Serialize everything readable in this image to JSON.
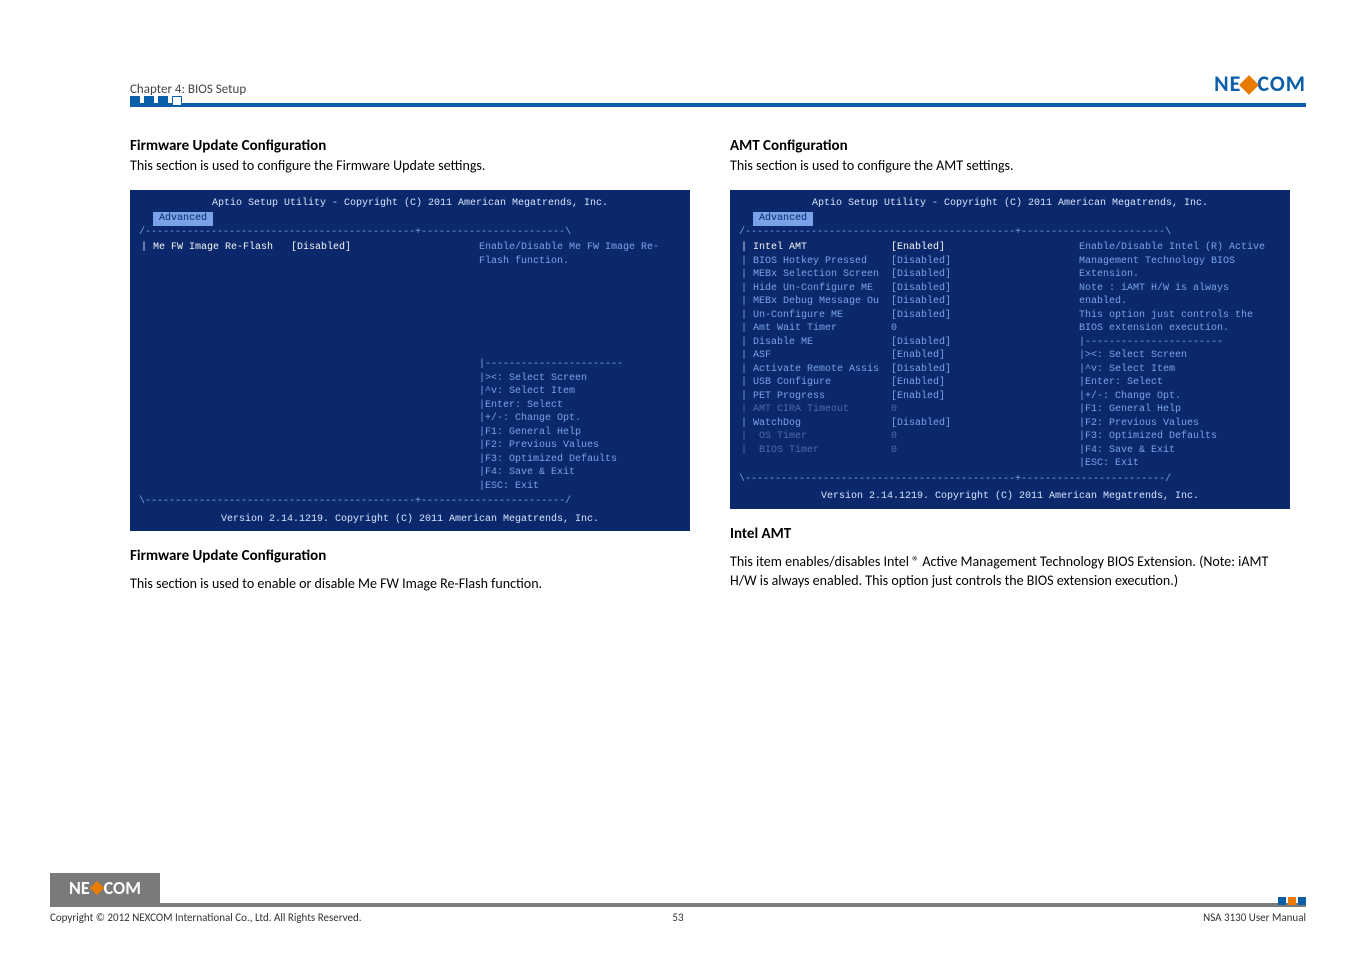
{
  "header": {
    "chapter": "Chapter 4: BIOS Setup"
  },
  "brand": {
    "left": "NE",
    "right": "COM"
  },
  "left": {
    "h_config": "Firmware Update Configuration",
    "desc_config": "This section is used to configure the Firmware Update settings.",
    "h_after": "Firmware Update Configuration",
    "desc_after": "This section is used to enable or disable Me FW Image Re-Flash function."
  },
  "right": {
    "h_config": "AMT Configuration",
    "desc_config": "This section is used to configure the AMT settings.",
    "h_after": "Intel AMT",
    "desc_after": "This item enables/disables Intel ® Active Management Technology BIOS Extension. (Note: iAMT H/W is always enabled. This option just controls the BIOS extension execution.)"
  },
  "bios_common": {
    "title": "Aptio Setup Utility - Copyright (C) 2011 American Megatrends, Inc.",
    "tab": "Advanced",
    "footer": "Version 2.14.1219. Copyright (C) 2011 American Megatrends, Inc.",
    "keys": [
      "><: Select Screen",
      "^v: Select Item",
      "Enter: Select",
      "+/-: Change Opt.",
      "F1: General Help",
      "F2: Previous Values",
      "F3: Optimized Defaults",
      "F4: Save & Exit",
      "ESC: Exit"
    ]
  },
  "bios_left": {
    "rows": [
      {
        "label": "Me FW Image Re-Flash",
        "value": "[Disabled]",
        "selected": true
      }
    ],
    "help": "Enable/Disable Me FW Image Re-Flash function."
  },
  "bios_right": {
    "rows": [
      {
        "label": "Intel AMT",
        "value": "[Enabled]",
        "selected": true
      },
      {
        "label": "BIOS Hotkey Pressed",
        "value": "[Disabled]"
      },
      {
        "label": "MEBx Selection Screen",
        "value": "[Disabled]"
      },
      {
        "label": "Hide Un-Configure ME",
        "value": "[Disabled]"
      },
      {
        "label": "MEBx Debug Message Ou",
        "value": "[Disabled]"
      },
      {
        "label": "Un-Configure ME",
        "value": "[Disabled]"
      },
      {
        "label": "Amt Wait Timer",
        "value": "0"
      },
      {
        "label": "Disable ME",
        "value": "[Disabled]"
      },
      {
        "label": "ASF",
        "value": "[Enabled]"
      },
      {
        "label": "Activate Remote Assis",
        "value": "[Disabled]"
      },
      {
        "label": "USB Configure",
        "value": "[Enabled]"
      },
      {
        "label": "PET Progress",
        "value": "[Enabled]"
      },
      {
        "label": "AMT CIRA Timeout",
        "value": "0",
        "sub": true
      },
      {
        "label": "WatchDog",
        "value": "[Disabled]"
      },
      {
        "label": " OS Timer",
        "value": "0",
        "sub": true
      },
      {
        "label": " BIOS Timer",
        "value": "0",
        "sub": true
      }
    ],
    "help": "Enable/Disable Intel (R) Active Management Technology BIOS Extension.\nNote : iAMT H/W is always enabled.\nThis option just controls the BIOS extension execution."
  },
  "footer": {
    "copyright": "Copyright © 2012 NEXCOM International Co., Ltd. All Rights Reserved.",
    "page": "53",
    "doc": "NSA 3130 User Manual"
  }
}
